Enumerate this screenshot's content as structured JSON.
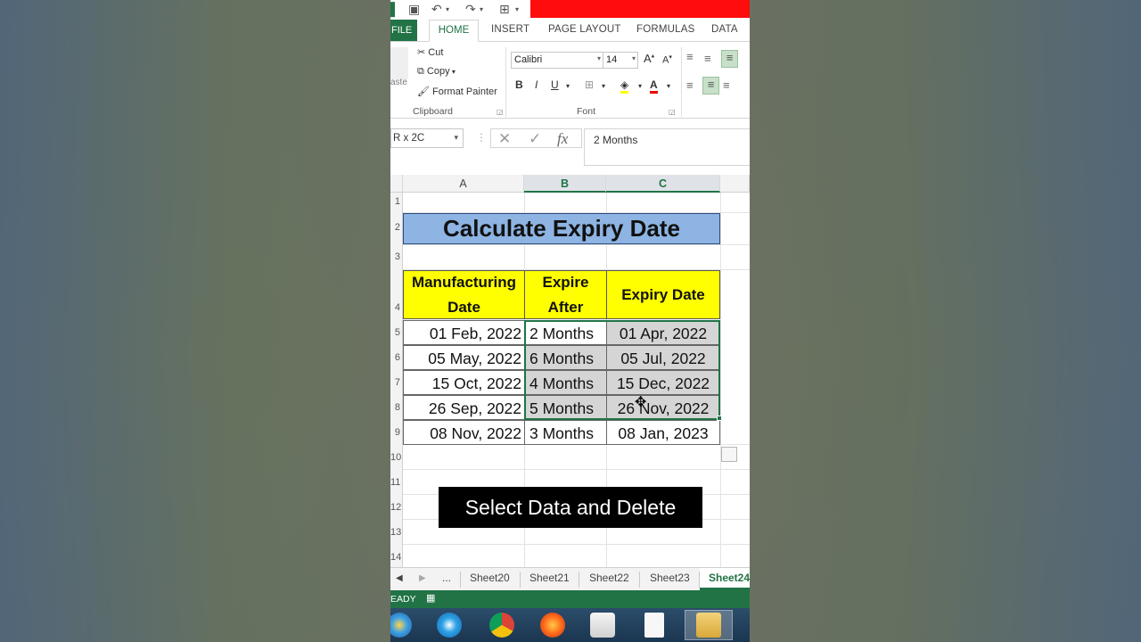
{
  "qat": {
    "undo_icon": "undo-icon",
    "redo_icon": "redo-icon",
    "save_icon": "save-icon"
  },
  "tabs": {
    "file": "FILE",
    "home": "HOME",
    "insert": "INSERT",
    "page_layout": "PAGE LAYOUT",
    "formulas": "FORMULAS",
    "data": "DATA"
  },
  "ribbon": {
    "clipboard": {
      "cut": "Cut",
      "copy": "Copy",
      "format_painter": "Format Painter",
      "paste_partial": "aste",
      "label": "Clipboard"
    },
    "font": {
      "name": "Calibri",
      "size": "14",
      "bold": "B",
      "italic": "I",
      "underline": "U",
      "grow": "A",
      "shrink": "A",
      "label": "Font"
    }
  },
  "formula_bar": {
    "name_box": "R x 2C",
    "fx": "fx",
    "value": "2 Months"
  },
  "columns": [
    "A",
    "B",
    "C"
  ],
  "rows": [
    "1",
    "2",
    "3",
    "4",
    "5",
    "6",
    "7",
    "8",
    "9",
    "10",
    "11",
    "12",
    "13",
    "14"
  ],
  "sheet": {
    "title": "Calculate Expiry Date",
    "headers": [
      {
        "line1": "Manufacturing",
        "line2": "Date"
      },
      {
        "line1": "Expire",
        "line2": "After"
      },
      {
        "line1": "Expiry Date",
        "line2": ""
      }
    ],
    "rows": [
      {
        "mfg": "01 Feb, 2022",
        "expire_after": "2 Months",
        "expiry": "01 Apr, 2022"
      },
      {
        "mfg": "05 May, 2022",
        "expire_after": "6 Months",
        "expiry": "05 Jul, 2022"
      },
      {
        "mfg": "15 Oct, 2022",
        "expire_after": "4 Months",
        "expiry": "15 Dec, 2022"
      },
      {
        "mfg": "26 Sep, 2022",
        "expire_after": "5 Months",
        "expiry": "26 Nov, 2022"
      },
      {
        "mfg": "08 Nov, 2022",
        "expire_after": "3 Months",
        "expiry": "08 Jan, 2023"
      }
    ]
  },
  "overlay": {
    "caption": "Select Data and Delete"
  },
  "sheet_tabs": {
    "ellipsis": "...",
    "tabs": [
      "Sheet20",
      "Sheet21",
      "Sheet22",
      "Sheet23"
    ],
    "active": "Sheet24"
  },
  "status": {
    "text": "EADY"
  },
  "colors": {
    "excel_green": "#217346",
    "title_fill": "#8db4e2",
    "header_fill": "#ffff00",
    "selection": "#d5d5d5"
  }
}
